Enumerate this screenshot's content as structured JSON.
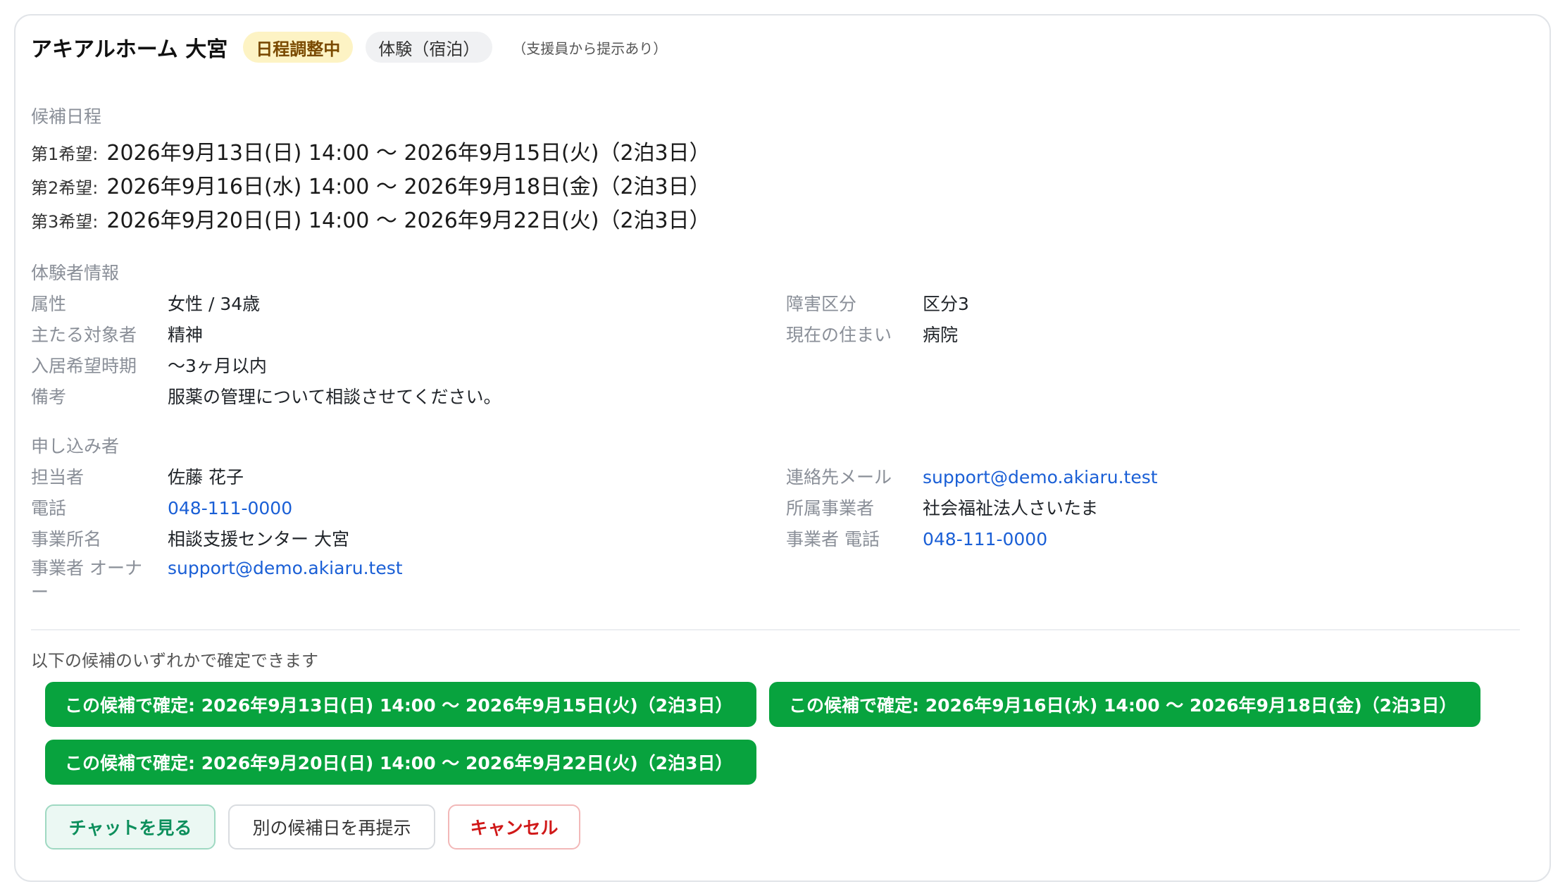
{
  "header": {
    "title": "アキアルホーム 大宮",
    "status_badge": "日程調整中",
    "type_badge": "体験（宿泊）",
    "note": "（支援員から提示あり）"
  },
  "candidates": {
    "section_title": "候補日程",
    "items": [
      {
        "label": "第1希望:",
        "value": "2026年9月13日(日) 14:00 〜 2026年9月15日(火)（2泊3日）"
      },
      {
        "label": "第2希望:",
        "value": "2026年9月16日(水) 14:00 〜 2026年9月18日(金)（2泊3日）"
      },
      {
        "label": "第3希望:",
        "value": "2026年9月20日(日) 14:00 〜 2026年9月22日(火)（2泊3日）"
      }
    ]
  },
  "experiencer": {
    "section_title": "体験者情報",
    "attribute_label": "属性",
    "attribute_value": "女性 / 34歳",
    "disability_label": "障害区分",
    "disability_value": "区分3",
    "target_label": "主たる対象者",
    "target_value": "精神",
    "residence_label": "現在の住まい",
    "residence_value": "病院",
    "move_in_label": "入居希望時期",
    "move_in_value": "〜3ヶ月以内",
    "remarks_label": "備考",
    "remarks_value": "服薬の管理について相談させてください。"
  },
  "applicant": {
    "section_title": "申し込み者",
    "person_label": "担当者",
    "person_value": "佐藤 花子",
    "email_label": "連絡先メール",
    "email_value": "support@demo.akiaru.test",
    "phone_label": "電話",
    "phone_value": "048-111-0000",
    "org_label": "所属事業者",
    "org_value": "社会福祉法人さいたま",
    "office_label": "事業所名",
    "office_value": "相談支援センター 大宮",
    "org_phone_label": "事業者 電話",
    "org_phone_value": "048-111-0000",
    "owner_label": "事業者 オーナー",
    "owner_value": "support@demo.akiaru.test"
  },
  "confirm": {
    "hint": "以下の候補のいずれかで確定できます",
    "buttons": [
      "この候補で確定: 2026年9月13日(日) 14:00 〜 2026年9月15日(火)（2泊3日）",
      "この候補で確定: 2026年9月16日(水) 14:00 〜 2026年9月18日(金)（2泊3日）",
      "この候補で確定: 2026年9月20日(日) 14:00 〜 2026年9月22日(火)（2泊3日）"
    ]
  },
  "actions": {
    "chat": "チャットを見る",
    "repropose": "別の候補日を再提示",
    "cancel": "キャンセル"
  },
  "colors": {
    "confirm_green": "#08a33e",
    "status_badge_bg": "#fdf3c4",
    "link_blue": "#1a5fd6",
    "cancel_red": "#d01818"
  }
}
